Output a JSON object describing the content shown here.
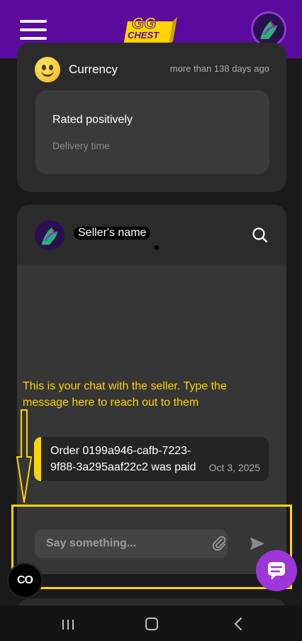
{
  "header": {
    "logo_line1": "GG",
    "logo_line2": "CHEST",
    "brand_color": "#5a0a9c",
    "accent_color": "#ffd400"
  },
  "review": {
    "icon": "smiley-emoji-icon",
    "category": "Currency",
    "time": "more than 138 days ago",
    "rating_text": "Rated positively",
    "detail_label": "Delivery time"
  },
  "chat": {
    "seller_name": "Seller's name",
    "annotation": "This is your chat with the seller. Type the message here to reach out to them",
    "messages": [
      {
        "text": "Order 0199a946-cafb-7223-9f88-3a295aaf22c2 was paid",
        "date": "Oct 3, 2025"
      }
    ],
    "input_placeholder": "Say something..."
  },
  "badge": {
    "label": "CO"
  },
  "icons": [
    "menu-icon",
    "search-icon",
    "paperclip-icon",
    "send-icon",
    "chat-bubble-icon",
    "recents-icon",
    "home-icon",
    "back-icon"
  ]
}
